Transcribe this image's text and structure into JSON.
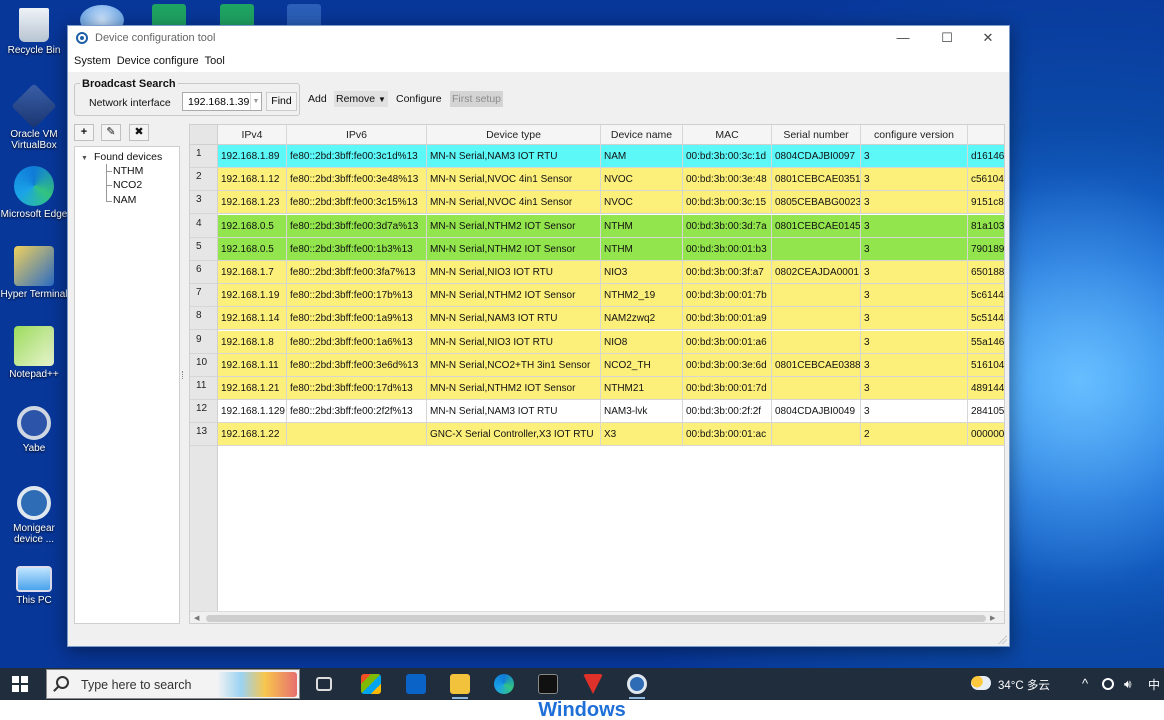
{
  "desktop": {
    "icons": [
      {
        "label": "Recycle Bin",
        "icon": "recycle-bin-icon"
      },
      {
        "label": "Oracle VM VirtualBox",
        "icon": "virtualbox-icon"
      },
      {
        "label": "Microsoft Edge",
        "icon": "edge-icon"
      },
      {
        "label": "Hyper Terminal",
        "icon": "hyperterminal-icon"
      },
      {
        "label": "Notepad++",
        "icon": "notepadpp-icon"
      },
      {
        "label": "Yabe",
        "icon": "yabe-icon"
      },
      {
        "label": "Monigear device ...",
        "icon": "monigear-icon"
      },
      {
        "label": "This PC",
        "icon": "this-pc-icon"
      }
    ]
  },
  "window": {
    "title": "Device configuration tool",
    "controls": {
      "minimize": "—",
      "maximize": "☐",
      "close": "✕"
    }
  },
  "menu": {
    "items": [
      "System",
      "Device configure",
      "Tool"
    ]
  },
  "broadcast": {
    "legend": "Broadcast Search",
    "interface_label": "Network interface",
    "interface_value": "192.168.1.39",
    "find_label": "Find"
  },
  "toolbar": {
    "add_label": "Add",
    "remove_label": "Remove",
    "configure_label": "Configure",
    "first_setup_label": "First setup"
  },
  "left_buttons": {
    "add": "+",
    "edit": "✎",
    "delete": "✖"
  },
  "tree": {
    "root": "Found devices",
    "children": [
      "NTHM",
      "NCO2",
      "NAM"
    ]
  },
  "grid": {
    "columns": [
      "IPv4",
      "IPv6",
      "Device type",
      "Device name",
      "MAC",
      "Serial number",
      "configure version",
      ""
    ],
    "colors": {
      "cyan": "#5cf7f7",
      "yellow": "#fdf07a",
      "green": "#92e54c",
      "white": "#ffffff"
    },
    "rows": [
      {
        "n": "1",
        "color": "cyan",
        "cells": [
          "192.168.1.89",
          "fe80::2bd:3bff:fe00:3c1d%13",
          "MN-N Serial,NAM3 IOT RTU",
          "NAM",
          "00:bd:3b:00:3c:1d",
          "0804CDAJBI0097",
          "3",
          "d16146"
        ]
      },
      {
        "n": "2",
        "color": "yellow",
        "cells": [
          "192.168.1.12",
          "fe80::2bd:3bff:fe00:3e48%13",
          "MN-N Serial,NVOC 4in1 Sensor",
          "NVOC",
          "00:bd:3b:00:3e:48",
          "0801CEBCAE0351",
          "3",
          "c56104"
        ]
      },
      {
        "n": "3",
        "color": "yellow",
        "cells": [
          "192.168.1.23",
          "fe80::2bd:3bff:fe00:3c15%13",
          "MN-N Serial,NVOC 4in1 Sensor",
          "NVOC",
          "00:bd:3b:00:3c:15",
          "0805CEBABG0023",
          "3",
          "9151c8"
        ]
      },
      {
        "n": "4",
        "color": "green",
        "cells": [
          "192.168.0.5",
          "fe80::2bd:3bff:fe00:3d7a%13",
          "MN-N Serial,NTHM2 IOT Sensor",
          "NTHM",
          "00:bd:3b:00:3d:7a",
          "0801CEBCAE0145",
          "3",
          "81a103"
        ]
      },
      {
        "n": "5",
        "color": "green",
        "cells": [
          "192.168.0.5",
          "fe80::2bd:3bff:fe00:1b3%13",
          "MN-N Serial,NTHM2 IOT Sensor",
          "NTHM",
          "00:bd:3b:00:01:b3",
          "",
          "3",
          "790189"
        ]
      },
      {
        "n": "6",
        "color": "yellow",
        "cells": [
          "192.168.1.7",
          "fe80::2bd:3bff:fe00:3fa7%13",
          "MN-N Serial,NIO3 IOT RTU",
          "NIO3",
          "00:bd:3b:00:3f:a7",
          "0802CEAJDA0001",
          "3",
          "650188"
        ]
      },
      {
        "n": "7",
        "color": "yellow",
        "cells": [
          "192.168.1.19",
          "fe80::2bd:3bff:fe00:17b%13",
          "MN-N Serial,NTHM2 IOT Sensor",
          "NTHM2_19",
          "00:bd:3b:00:01:7b",
          "",
          "3",
          "5c6144"
        ]
      },
      {
        "n": "8",
        "color": "yellow",
        "cells": [
          "192.168.1.14",
          "fe80::2bd:3bff:fe00:1a9%13",
          "MN-N Serial,NAM3 IOT RTU",
          "NAM2zwq2",
          "00:bd:3b:00:01:a9",
          "",
          "3",
          "5c5144"
        ]
      },
      {
        "n": "9",
        "color": "yellow",
        "cells": [
          "192.168.1.8",
          "fe80::2bd:3bff:fe00:1a6%13",
          "MN-N Serial,NIO3 IOT RTU",
          "NIO8",
          "00:bd:3b:00:01:a6",
          "",
          "3",
          "55a146"
        ]
      },
      {
        "n": "10",
        "color": "yellow",
        "cells": [
          "192.168.1.11",
          "fe80::2bd:3bff:fe00:3e6d%13",
          "MN-N Serial,NCO2+TH 3in1 Sensor",
          "NCO2_TH",
          "00:bd:3b:00:3e:6d",
          "0801CEBCAE0388",
          "3",
          "516104"
        ]
      },
      {
        "n": "11",
        "color": "yellow",
        "cells": [
          "192.168.1.21",
          "fe80::2bd:3bff:fe00:17d%13",
          "MN-N Serial,NTHM2 IOT Sensor",
          "NTHM21",
          "00:bd:3b:00:01:7d",
          "",
          "3",
          "489144"
        ]
      },
      {
        "n": "12",
        "color": "white",
        "cells": [
          "192.168.1.129",
          "fe80::2bd:3bff:fe00:2f2f%13",
          "MN-N Serial,NAM3 IOT RTU",
          "NAM3-lvk",
          "00:bd:3b:00:2f:2f",
          "0804CDAJBI0049",
          "3",
          "284105"
        ]
      },
      {
        "n": "13",
        "color": "yellow",
        "cells": [
          "192.168.1.22",
          "",
          "GNC-X Serial Controller,X3 IOT RTU",
          "X3",
          "00:bd:3b:00:01:ac",
          "",
          "2",
          "000000"
        ]
      }
    ]
  },
  "taskbar": {
    "search_placeholder": "Type here to search",
    "apps": [
      "task-view-icon",
      "store-icon",
      "outlook-icon",
      "file-explorer-icon",
      "edge-icon",
      "terminal-icon",
      "wps-icon",
      "device-config-icon"
    ],
    "weather": "34°C 多云",
    "tray_chevron": "^"
  },
  "caption": "Windows"
}
